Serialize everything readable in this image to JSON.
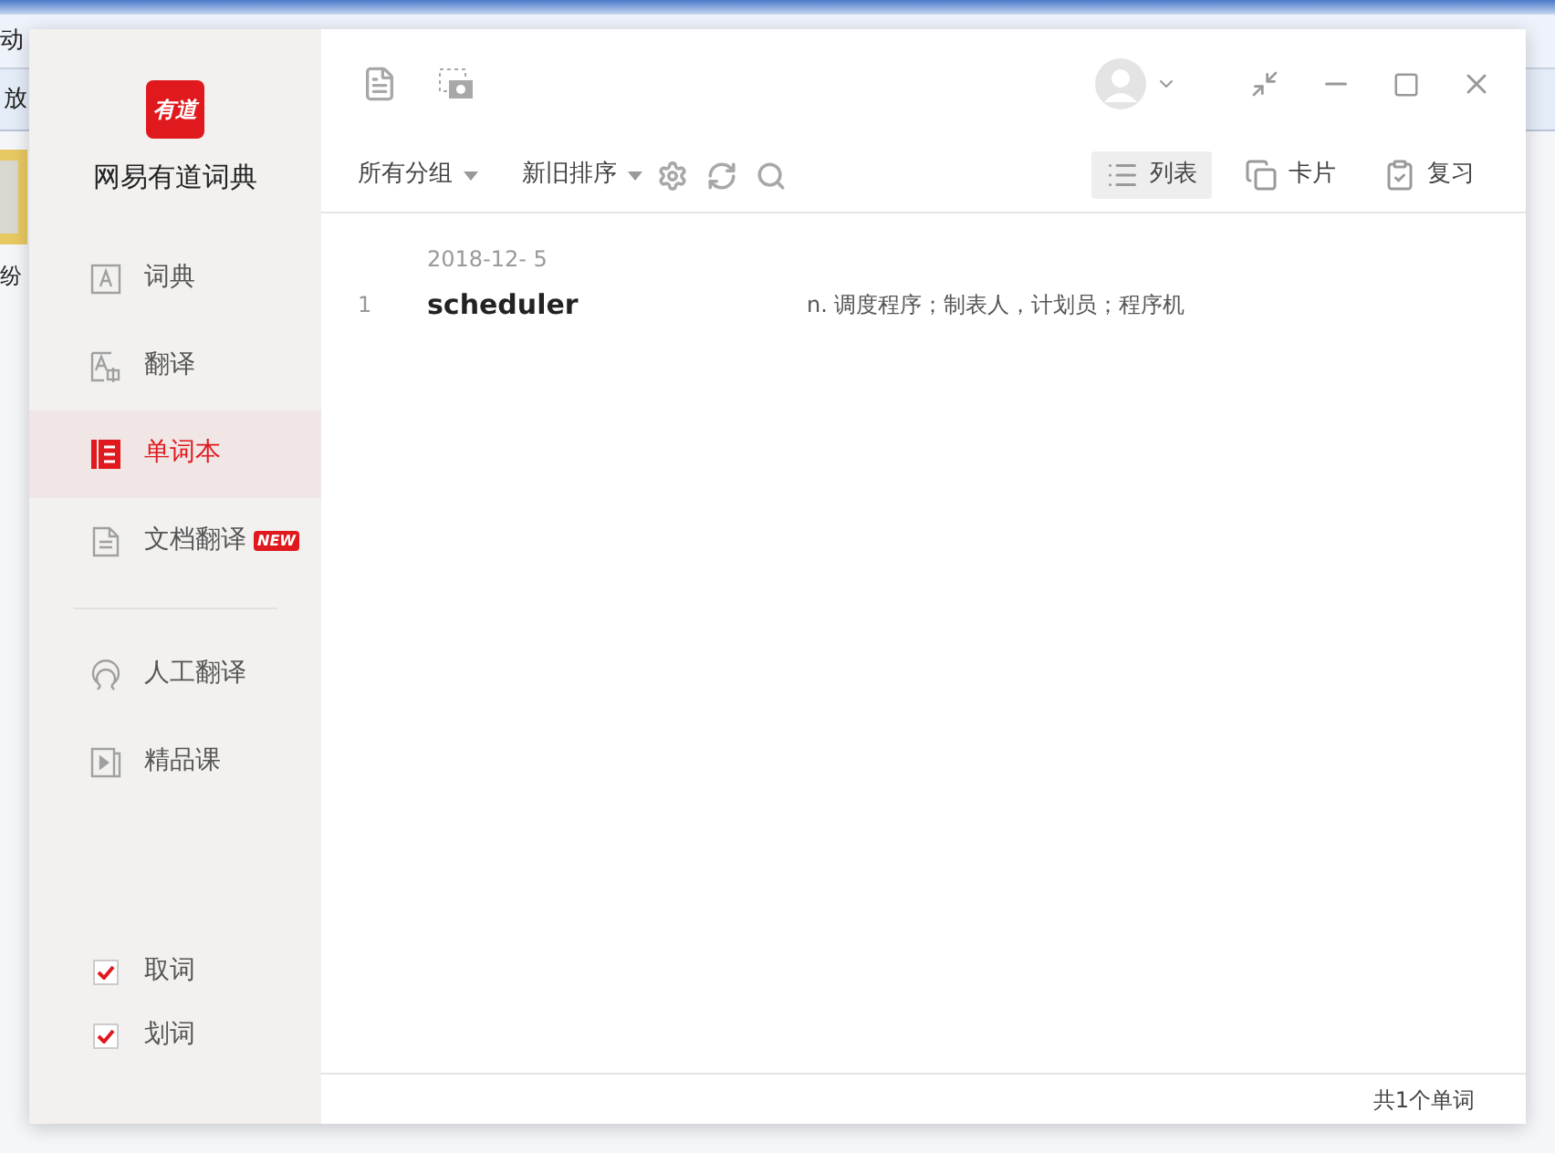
{
  "background_window": {
    "menu_fragment": "动",
    "toolbar_fragment": "放",
    "file_label": "纷"
  },
  "app": {
    "logo_text": "有道",
    "name": "网易有道词典"
  },
  "nav": [
    {
      "kind": "dict",
      "label": "词典",
      "selected": false
    },
    {
      "kind": "translate",
      "label": "翻译",
      "selected": false
    },
    {
      "kind": "wordbook",
      "label": "单词本",
      "selected": true
    },
    {
      "kind": "document",
      "label": "文档翻译",
      "selected": false,
      "badge": "NEW"
    },
    {
      "kind": "divider"
    },
    {
      "kind": "human",
      "label": "人工翻译",
      "selected": false
    },
    {
      "kind": "course",
      "label": "精品课",
      "selected": false
    }
  ],
  "options": [
    {
      "label": "取词",
      "checked": true
    },
    {
      "label": "划词",
      "checked": true
    }
  ],
  "toolbar": {
    "group_filter": "所有分组",
    "sort": "新旧排序",
    "views": [
      {
        "kind": "list",
        "label": "列表",
        "selected": true
      },
      {
        "kind": "card",
        "label": "卡片",
        "selected": false
      },
      {
        "kind": "review",
        "label": "复习",
        "selected": false
      }
    ]
  },
  "word_list": {
    "date": "2018-12- 5",
    "entries": [
      {
        "index": "1",
        "word": "scheduler",
        "definition": "n. 调度程序；制表人，计划员；程序机"
      }
    ]
  },
  "footer": {
    "count": "共1个单词"
  }
}
